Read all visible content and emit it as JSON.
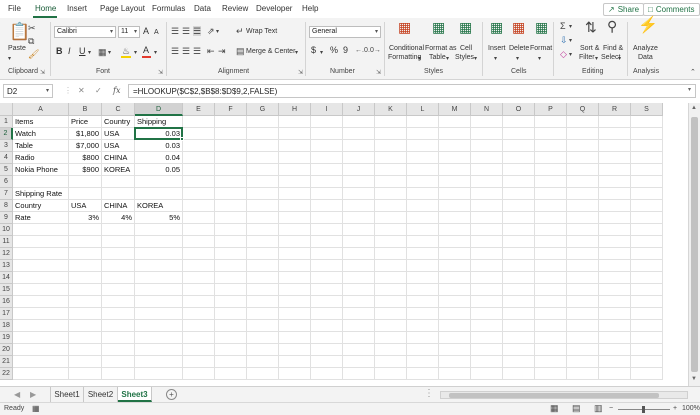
{
  "menu": {
    "items": [
      "File",
      "Home",
      "Insert",
      "Page Layout",
      "Formulas",
      "Data",
      "Review",
      "Developer",
      "Help"
    ],
    "active_index": 1,
    "share_label": "Share",
    "comments_label": "Comments"
  },
  "ribbon": {
    "clipboard": {
      "paste": "Paste",
      "label": "Clipboard"
    },
    "font": {
      "name": "Calibri",
      "size": "11",
      "label": "Font",
      "bold": "B",
      "italic": "I",
      "underline": "U",
      "grow": "A",
      "shrink": "A"
    },
    "alignment": {
      "wrap_text": "Wrap Text",
      "merge_center": "Merge & Center",
      "label": "Alignment"
    },
    "number": {
      "format": "General",
      "currency": "$",
      "percent": "%",
      "comma": "9",
      "label": "Number"
    },
    "styles": {
      "conditional_1": "Conditional",
      "conditional_2": "Formatting",
      "format_as_1": "Format as",
      "format_as_2": "Table",
      "cell_1": "Cell",
      "cell_2": "Styles",
      "label": "Styles"
    },
    "cells": {
      "insert": "Insert",
      "delete": "Delete",
      "format": "Format",
      "label": "Cells"
    },
    "editing": {
      "sort_1": "Sort &",
      "sort_2": "Filter",
      "find_1": "Find &",
      "find_2": "Select",
      "label": "Editing"
    },
    "analysis": {
      "analyze_1": "Analyze",
      "analyze_2": "Data",
      "label": "Analysis"
    },
    "accent_color": "#217346",
    "font_color_bar": "#e23b2e",
    "fill_color_bar": "#f5d200"
  },
  "formula_bar": {
    "name_box": "D2",
    "formula": "=HLOOKUP($C$2,$B$8:$D$9,2,FALSE)"
  },
  "grid": {
    "columns": [
      "A",
      "B",
      "C",
      "D",
      "E",
      "F",
      "G",
      "H",
      "I",
      "J",
      "K",
      "L",
      "M",
      "N",
      "O",
      "P",
      "Q",
      "R",
      "S"
    ],
    "rows": [
      "1",
      "2",
      "3",
      "4",
      "5",
      "6",
      "7",
      "8",
      "9",
      "10",
      "11",
      "12",
      "13",
      "14",
      "15",
      "16",
      "17",
      "18",
      "19",
      "20",
      "21",
      "22"
    ],
    "selected_col": "D",
    "selected_row": "2",
    "cells": {
      "A1": "Items",
      "B1": "Price",
      "C1": "Country",
      "D1": "Shipping",
      "A2": "Watch",
      "B2": "$1,800",
      "C2": "USA",
      "D2": "0.03",
      "A3": " Table",
      "B3": "$7,000",
      "C3": "USA",
      "D3": "0.03",
      "A4": "Radio",
      "B4": "$800",
      "C4": "CHINA",
      "D4": "0.04",
      "A5": "Nokia Phone",
      "B5": "$900",
      "C5": "KOREA",
      "D5": "0.05",
      "A7": "Shipping Rate",
      "A8": "Country",
      "B8": "USA",
      "C8": "CHINA",
      "D8": "KOREA",
      "A9": "Rate",
      "B9": "3%",
      "C9": "4%",
      "D9": "5%"
    },
    "numeric_cells": [
      "B2",
      "B3",
      "B4",
      "B5",
      "D2",
      "D3",
      "D4",
      "D5",
      "B9",
      "C9",
      "D9"
    ]
  },
  "sheets": {
    "tabs": [
      "Sheet1",
      "Sheet2",
      "Sheet3"
    ],
    "active_index": 2,
    "add_label": "+"
  },
  "status": {
    "ready": "Ready",
    "zoom": "100%"
  }
}
